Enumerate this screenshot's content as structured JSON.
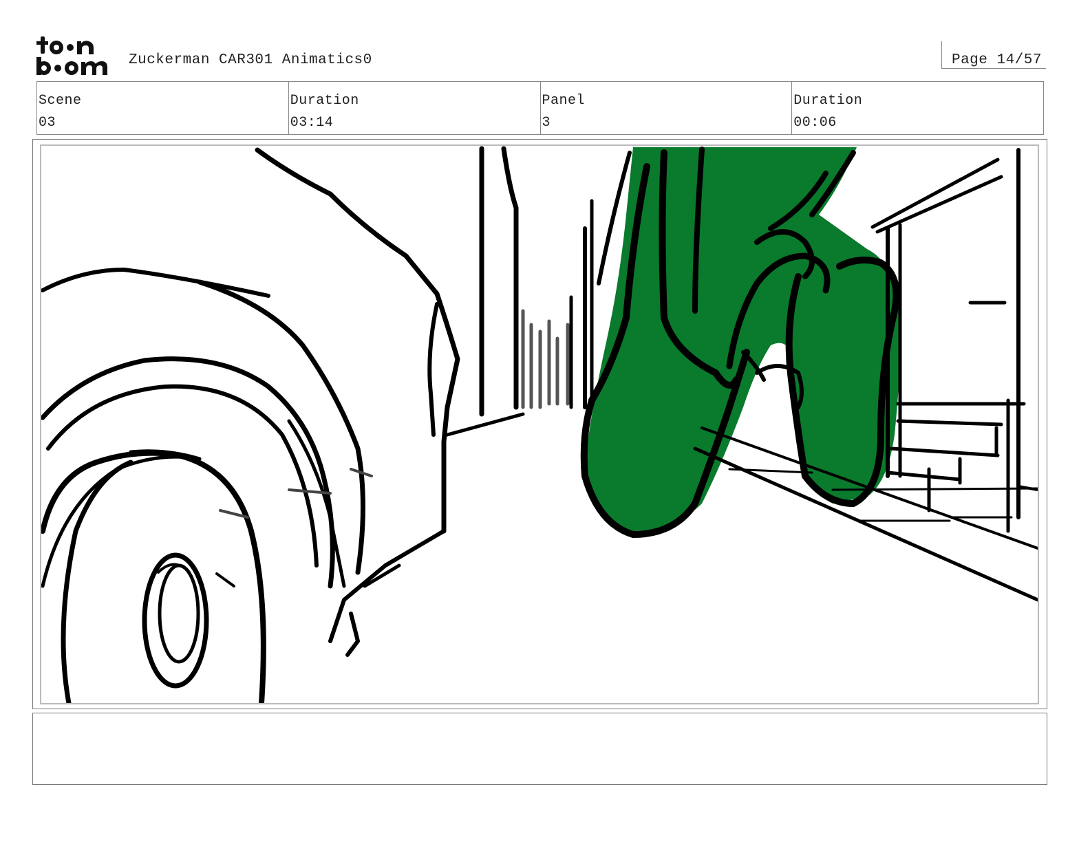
{
  "header": {
    "logo_icon": "toon-boom-logo",
    "logo_text": "toon boom",
    "title": "Zuckerman CAR301 Animatics0",
    "page": "Page 14/57"
  },
  "info": {
    "scene_label": "Scene",
    "scene_value": "03",
    "scene_duration_label": "Duration",
    "scene_duration_value": "03:14",
    "panel_label": "Panel",
    "panel_value": "3",
    "panel_duration_label": "Duration",
    "panel_duration_value": "00:06"
  },
  "panel": {
    "image": "storyboard-sketch",
    "accent_color": "#0a7a2c"
  },
  "notes": {
    "text": ""
  }
}
